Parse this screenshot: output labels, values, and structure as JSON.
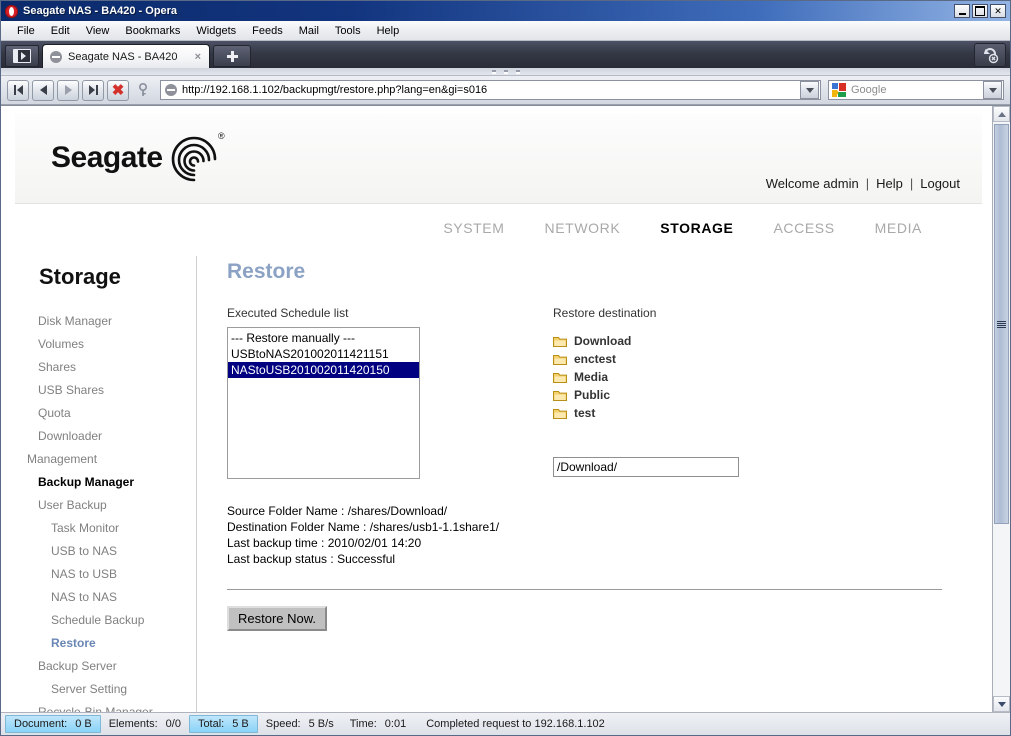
{
  "window": {
    "title": "Seagate NAS - BA420 - Opera",
    "app_icon": "opera-logo-icon",
    "minimize_label": "",
    "maximize_label": "",
    "close_label": ""
  },
  "menubar": {
    "items": [
      "File",
      "Edit",
      "View",
      "Bookmarks",
      "Widgets",
      "Feeds",
      "Mail",
      "Tools",
      "Help"
    ]
  },
  "tabbar": {
    "panel_toggle_icon": "panel-toggle-icon",
    "tabs": [
      {
        "title": "Seagate NAS - BA420",
        "favicon": "page-favicon-icon",
        "close_label": "×"
      }
    ],
    "new_tab_icon": "plus-icon",
    "reload_icon": "reload-icon"
  },
  "addressbar": {
    "buttons": [
      {
        "name": "rewind-button",
        "icon": "rewind-icon"
      },
      {
        "name": "back-button",
        "icon": "arrow-left-icon"
      },
      {
        "name": "forward-button",
        "icon": "arrow-right-icon"
      },
      {
        "name": "fast-forward-button",
        "icon": "fast-forward-icon"
      },
      {
        "name": "stop-button",
        "icon": "stop-x-icon"
      },
      {
        "name": "security-button",
        "icon": "key-icon"
      }
    ],
    "url": "http://192.168.1.102/backupmgt/restore.php?lang=en&gi=s016",
    "url_favicon": "page-favicon-icon",
    "url_dropdown_icon": "chevron-down-icon",
    "search": {
      "engine_icon": "google-icon",
      "placeholder": "Google",
      "value": "",
      "dropdown_icon": "chevron-down-icon"
    }
  },
  "page": {
    "brand": {
      "name": "Seagate",
      "registered_mark": "®",
      "logo_icon": "seagate-swirl-icon"
    },
    "account": {
      "welcome": "Welcome admin",
      "separator": "|",
      "help": "Help",
      "logout": "Logout"
    },
    "nav": [
      {
        "label": "SYSTEM",
        "active": false
      },
      {
        "label": "NETWORK",
        "active": false
      },
      {
        "label": "STORAGE",
        "active": true
      },
      {
        "label": "ACCESS",
        "active": false
      },
      {
        "label": "MEDIA",
        "active": false
      }
    ],
    "sidebar": {
      "title": "Storage",
      "items": [
        {
          "label": "Disk Manager",
          "level": 0,
          "state": "normal"
        },
        {
          "label": "Volumes",
          "level": 0,
          "state": "normal"
        },
        {
          "label": "Shares",
          "level": 0,
          "state": "normal"
        },
        {
          "label": "USB Shares",
          "level": 0,
          "state": "normal"
        },
        {
          "label": "Quota",
          "level": 0,
          "state": "normal"
        },
        {
          "label": "Downloader",
          "level": 0,
          "state": "normal"
        },
        {
          "label": "Management",
          "level": -1,
          "state": "normal"
        },
        {
          "label": "Backup Manager",
          "level": 0,
          "state": "bold"
        },
        {
          "label": "User Backup",
          "level": 0,
          "state": "normal"
        },
        {
          "label": "Task Monitor",
          "level": 1,
          "state": "normal"
        },
        {
          "label": "USB to NAS",
          "level": 1,
          "state": "normal"
        },
        {
          "label": "NAS to USB",
          "level": 1,
          "state": "normal"
        },
        {
          "label": "NAS to NAS",
          "level": 1,
          "state": "normal"
        },
        {
          "label": "Schedule Backup",
          "level": 1,
          "state": "normal"
        },
        {
          "label": "Restore",
          "level": 1,
          "state": "active"
        },
        {
          "label": "Backup Server",
          "level": 0,
          "state": "normal"
        },
        {
          "label": "Server Setting",
          "level": 1,
          "state": "normal"
        },
        {
          "label": "Recycle-Bin Manager",
          "level": 0,
          "state": "normal"
        }
      ]
    },
    "main": {
      "title": "Restore",
      "schedule_list": {
        "label": "Executed Schedule list",
        "options": [
          {
            "text": "--- Restore manually ---",
            "selected": false
          },
          {
            "text": "USBtoNAS201002011421151",
            "selected": false
          },
          {
            "text": "NAStoUSB201002011420150",
            "selected": true
          }
        ]
      },
      "destination": {
        "label": "Restore destination",
        "folders": [
          {
            "name": "Download",
            "icon": "folder-icon"
          },
          {
            "name": "enctest",
            "icon": "folder-icon"
          },
          {
            "name": "Media",
            "icon": "folder-icon"
          },
          {
            "name": "Public",
            "icon": "folder-icon"
          },
          {
            "name": "test",
            "icon": "folder-icon"
          }
        ],
        "path_value": "/Download/",
        "path_placeholder": ""
      },
      "details": [
        "Source Folder Name : /shares/Download/",
        "Destination Folder Name : /shares/usb1-1.1share1/",
        "Last backup time : 2010/02/01 14:20",
        "Last backup status : Successful"
      ],
      "restore_button": "Restore Now."
    }
  },
  "statusbar": {
    "cells": [
      {
        "label": "Document:",
        "value": "0 B",
        "highlight": true
      },
      {
        "label": "Elements:",
        "value": "0/0",
        "highlight": false
      },
      {
        "label": "Total:",
        "value": "5 B",
        "highlight": true
      },
      {
        "label": "Speed:",
        "value": "5 B/s",
        "highlight": false
      },
      {
        "label": "Time:",
        "value": "0:01",
        "highlight": false
      }
    ],
    "message": "Completed request to 192.168.1.102"
  },
  "colors": {
    "title_blue": "#0b2a6b",
    "selection_navy": "#000080",
    "heading_blue": "#8ba2c4",
    "active_link_blue": "#6a87b4",
    "folder_yellow": "#f0c040",
    "status_highlight": "#89d3f7"
  }
}
